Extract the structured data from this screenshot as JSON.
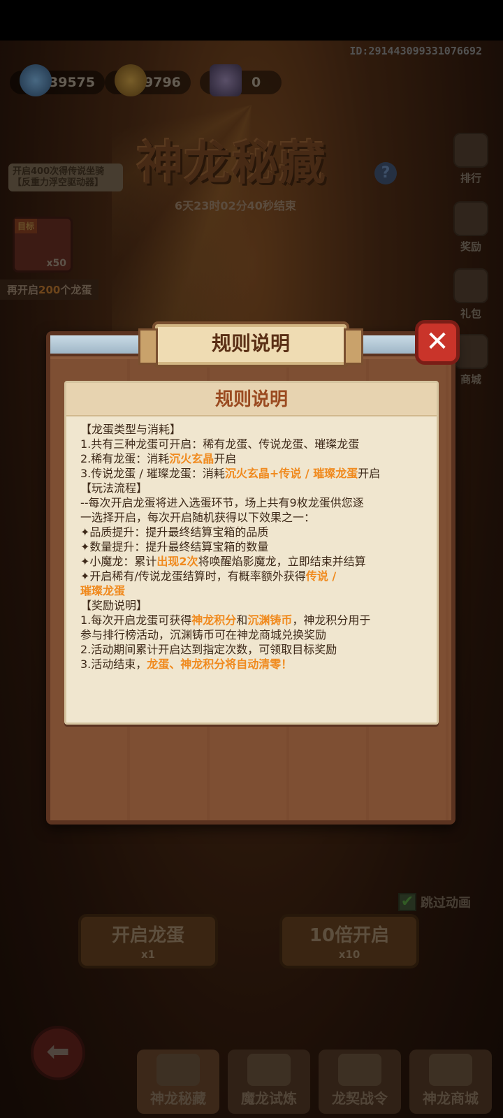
{
  "header": {
    "id_text": "ID:2914430993310766​92",
    "currencies": [
      {
        "icon": "blue-crystal-icon",
        "value": "39575"
      },
      {
        "icon": "gold-coin-icon",
        "value": "9796"
      },
      {
        "icon": "treasure-book-icon",
        "value": "0"
      }
    ]
  },
  "event": {
    "title": "神龙秘藏",
    "countdown": "6天23时02分40秒结束",
    "help": "?"
  },
  "side_menu": [
    {
      "label": "排行",
      "icon": "rank-icon"
    },
    {
      "label": "奖励",
      "icon": "reward-icon"
    },
    {
      "label": "礼包",
      "icon": "gift-bag-icon"
    },
    {
      "label": "商城",
      "icon": "shop-icon"
    }
  ],
  "target": {
    "tip": "开启400次得传说坐骑【反重力浮空驱动器】",
    "tag": "目标",
    "count": "x50",
    "remain_prefix": "再开启",
    "remain_num": "200",
    "remain_suffix": "个龙蛋"
  },
  "modal": {
    "banner_title": "规则说明",
    "paper_title": "规则说明",
    "close": "✕",
    "rules": {
      "s1_head": "【龙蛋类型与消耗】",
      "s1_l1": "1.共有三种龙蛋可开启：稀有龙蛋、传说龙蛋、璀璨龙蛋",
      "s1_l2a": "2.稀有龙蛋：消耗",
      "s1_l2b": "沉火玄晶",
      "s1_l2c": "开启",
      "s1_l3a": "3.传说龙蛋 / 璀璨龙蛋：消耗",
      "s1_l3b": "沉火玄晶+传说 / 璀璨龙蛋",
      "s1_l3c": "开启",
      "s2_head": "【玩法流程】",
      "s2_l1": "--每次开启龙蛋将进入选蛋环节，场上共有9枚龙蛋供您逐",
      "s2_l2": "一选择开启，每次开启随机获得以下效果之一：",
      "s2_l3": "✦品质提升：提升最终结算宝箱的品质",
      "s2_l4": "✦数量提升：提升最终结算宝箱的数量",
      "s2_l5a": "✦小魔龙：累计",
      "s2_l5b": "出现2次",
      "s2_l5c": "将唤醒焰影魔龙，立即结束并结算",
      "s2_l6a": "✦开启稀有/传说龙蛋结算时，有概率额外获得",
      "s2_l6b": "传说 /",
      "s2_l7": "璀璨龙蛋",
      "s3_head": "【奖励说明】",
      "s3_l1a": "1.每次开启龙蛋可获得",
      "s3_l1b": "神龙积分",
      "s3_l1c": "和",
      "s3_l1d": "沉渊铸币",
      "s3_l1e": "，神龙积分用于",
      "s3_l2": "参与排行榜活动，沉渊铸币可在神龙商城兑换奖励",
      "s3_l3": "2.活动期间累计开启达到指定次数，可领取目标奖励",
      "s3_l4a": "3.活动结束，",
      "s3_l4b": "龙蛋、神龙积分将自动清零！"
    }
  },
  "actions": {
    "open_once": "开启龙蛋",
    "open_once_cost": "x1",
    "open_ten": "10倍开启",
    "open_ten_cost": "x10",
    "skip_label": "跳过动画",
    "skip_checked": "✔"
  },
  "tabs": [
    {
      "label": "神龙秘藏",
      "icon": "dragon-icon"
    },
    {
      "label": "魔龙试炼",
      "icon": "trial-chest-icon"
    },
    {
      "label": "龙契战令",
      "icon": "crown-icon"
    },
    {
      "label": "神龙商城",
      "icon": "shop-building-icon"
    }
  ],
  "back": "⬅"
}
